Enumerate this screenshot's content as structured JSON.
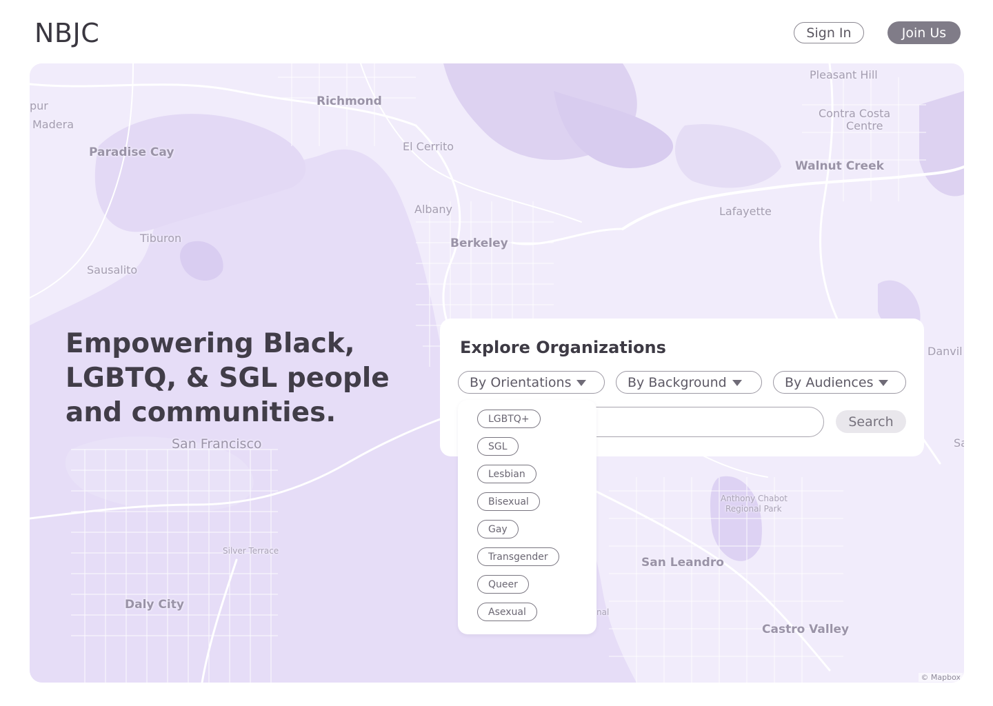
{
  "header": {
    "logo": "NBJC",
    "sign_in_label": "Sign In",
    "join_label": "Join Us"
  },
  "map": {
    "labels": [
      {
        "text": "Pleasant Hill",
        "size": "mid"
      },
      {
        "text": "Richmond",
        "size": "big"
      },
      {
        "text": "Contra Costa",
        "size": "mid"
      },
      {
        "text": "Centre",
        "size": "mid"
      },
      {
        "text": "pur",
        "size": "mid"
      },
      {
        "text": "Madera",
        "size": "mid"
      },
      {
        "text": "El Cerrito",
        "size": "mid"
      },
      {
        "text": "Paradise Cay",
        "size": "big"
      },
      {
        "text": "Walnut Creek",
        "size": "big"
      },
      {
        "text": "Albany",
        "size": "mid"
      },
      {
        "text": "Lafayette",
        "size": "mid"
      },
      {
        "text": "Tiburon",
        "size": "mid"
      },
      {
        "text": "Berkeley",
        "size": "big"
      },
      {
        "text": "Sausalito",
        "size": "mid"
      },
      {
        "text": "Danvil",
        "size": "mid"
      },
      {
        "text": "San Francisco",
        "size": "big"
      },
      {
        "text": "Sa",
        "size": "mid"
      },
      {
        "text": "Anthony Chabot",
        "size": "small"
      },
      {
        "text": "Regional Park",
        "size": "small"
      },
      {
        "text": "Silver Terrace",
        "size": "small"
      },
      {
        "text": "San Leandro",
        "size": "big"
      },
      {
        "text": "Daly City",
        "size": "big"
      },
      {
        "text": "nal",
        "size": "small"
      },
      {
        "text": "Castro Valley",
        "size": "big"
      }
    ],
    "attribution": "© Mapbox"
  },
  "hero": {
    "headline": "Empowering Black,\nLGBTQ, &  SGL people\nand communities."
  },
  "explore": {
    "title": "Explore Organizations",
    "filters": [
      {
        "label": "By Orientations"
      },
      {
        "label": "By Background"
      },
      {
        "label": "By Audiences"
      }
    ],
    "search_value": "",
    "search_button": "Search"
  },
  "orientations_dropdown": {
    "options": [
      "LGBTQ+",
      "SGL",
      "Lesbian",
      "Bisexual",
      "Gay",
      "Transgender",
      "Queer",
      "Asexual"
    ]
  },
  "colors": {
    "map_land": "#f1ecfb",
    "map_water": "#e5dcf6",
    "map_park": "#ddd2f3",
    "accent_button": "#807c88"
  }
}
